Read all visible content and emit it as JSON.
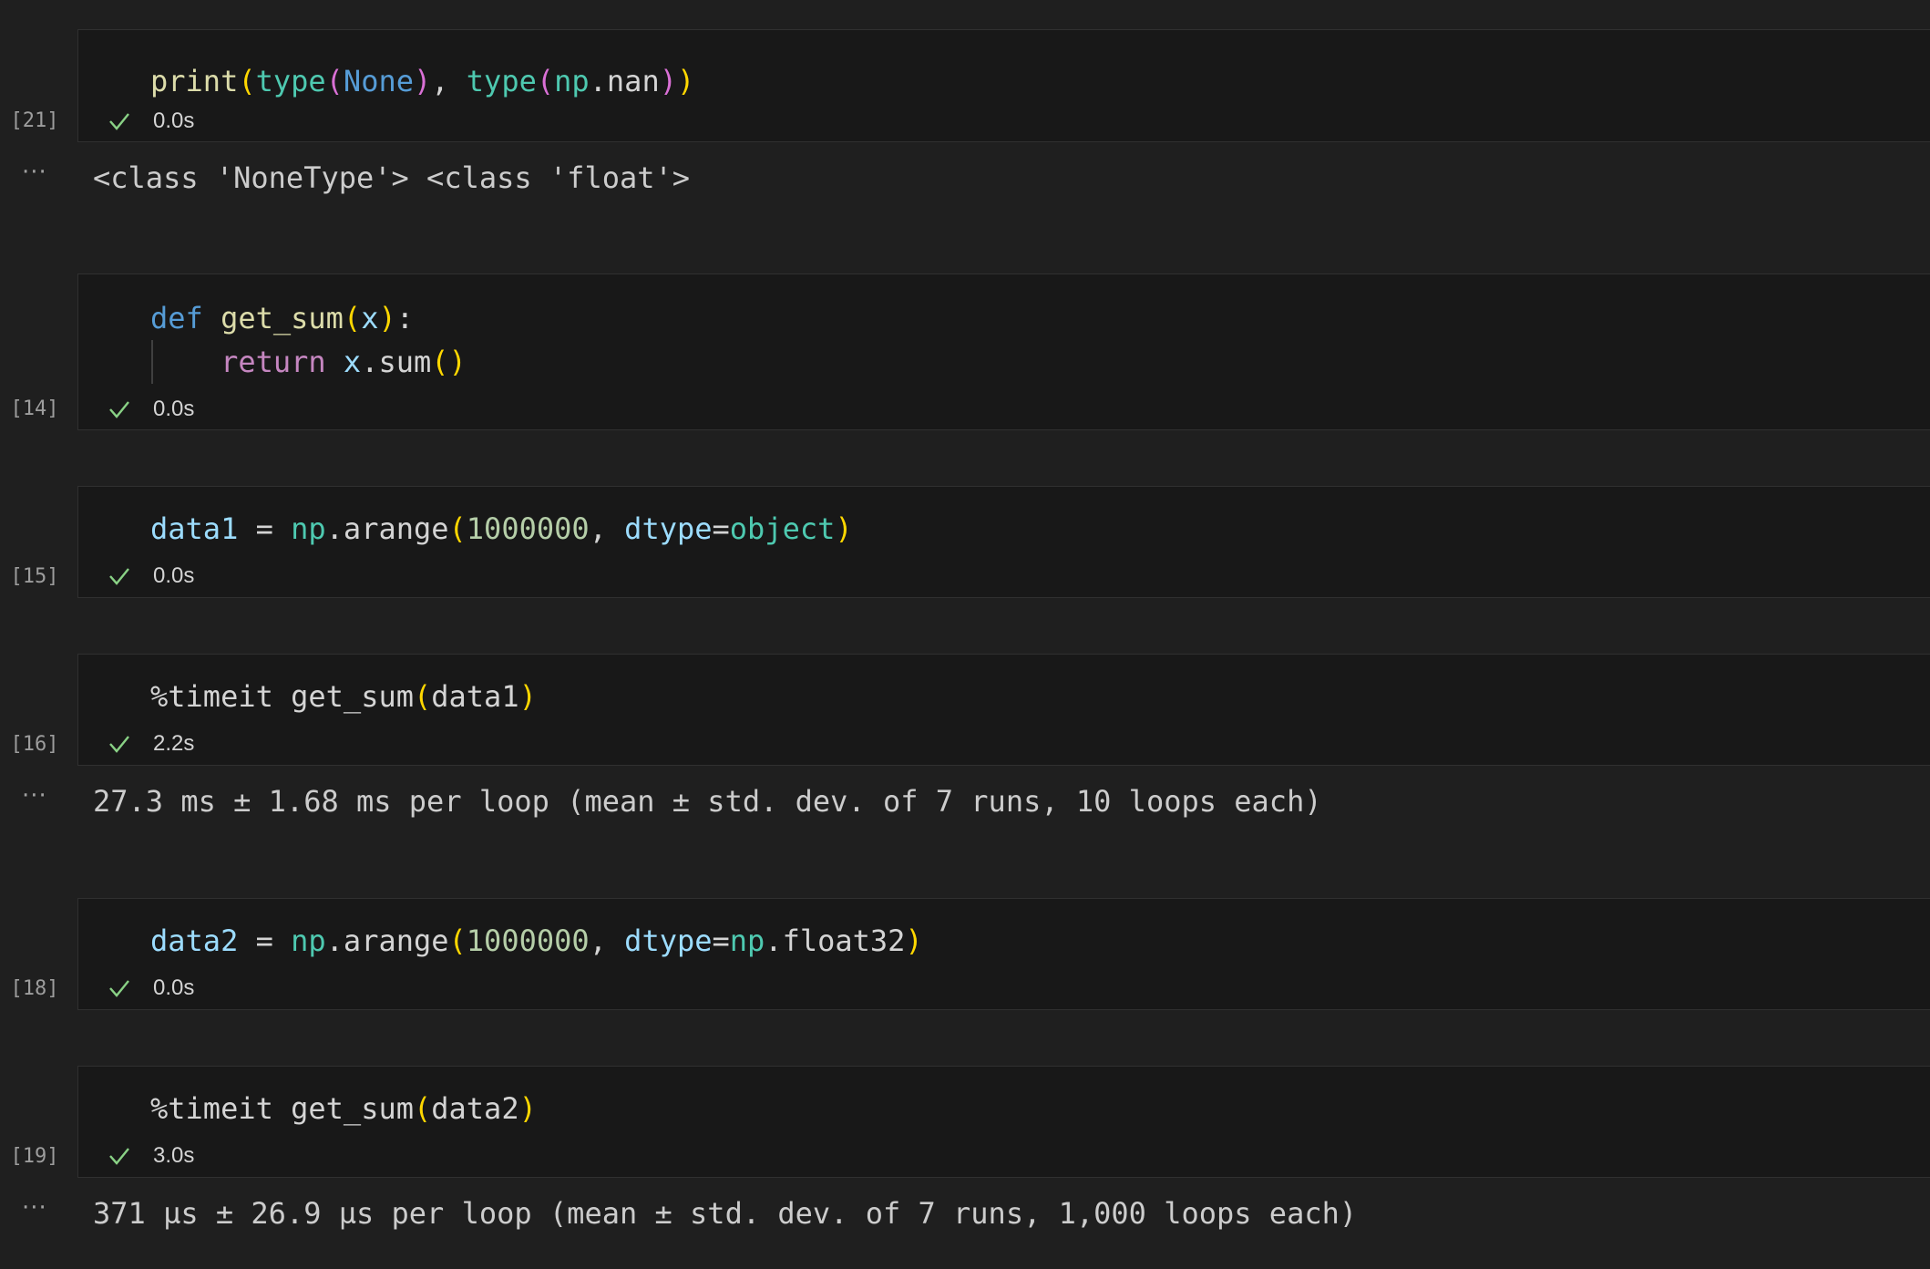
{
  "cells": [
    {
      "exec_count": "[21]",
      "code": [
        [
          {
            "t": "print",
            "c": "fn"
          },
          {
            "t": "(",
            "c": "p1"
          },
          {
            "t": "type",
            "c": "bi"
          },
          {
            "t": "(",
            "c": "p2"
          },
          {
            "t": "None",
            "c": "kw"
          },
          {
            "t": ")",
            "c": "p2"
          },
          {
            "t": ", ",
            "c": "plain"
          },
          {
            "t": "type",
            "c": "bi"
          },
          {
            "t": "(",
            "c": "p2"
          },
          {
            "t": "np",
            "c": "mod"
          },
          {
            "t": ".nan",
            "c": "plain"
          },
          {
            "t": ")",
            "c": "p2"
          },
          {
            "t": ")",
            "c": "p1"
          }
        ]
      ],
      "status": "success",
      "exec_time": "0.0s",
      "output": "<class 'NoneType'> <class 'float'>",
      "output_menu": "···"
    },
    {
      "exec_count": "[14]",
      "code": [
        [
          {
            "t": "def",
            "c": "kw"
          },
          {
            "t": " ",
            "c": "plain"
          },
          {
            "t": "get_sum",
            "c": "fn"
          },
          {
            "t": "(",
            "c": "p1"
          },
          {
            "t": "x",
            "c": "var"
          },
          {
            "t": ")",
            "c": "p1"
          },
          {
            "t": ":",
            "c": "plain"
          }
        ],
        [
          {
            "t": "    ",
            "c": "plain"
          },
          {
            "t": "return",
            "c": "kw2"
          },
          {
            "t": " ",
            "c": "plain"
          },
          {
            "t": "x",
            "c": "var"
          },
          {
            "t": ".sum",
            "c": "plain"
          },
          {
            "t": "()",
            "c": "p1"
          }
        ]
      ],
      "status": "success",
      "exec_time": "0.0s"
    },
    {
      "exec_count": "[15]",
      "code": [
        [
          {
            "t": "data1",
            "c": "var"
          },
          {
            "t": " = ",
            "c": "plain"
          },
          {
            "t": "np",
            "c": "mod"
          },
          {
            "t": ".arange",
            "c": "plain"
          },
          {
            "t": "(",
            "c": "p1"
          },
          {
            "t": "1000000",
            "c": "num"
          },
          {
            "t": ", ",
            "c": "plain"
          },
          {
            "t": "dtype",
            "c": "var"
          },
          {
            "t": "=",
            "c": "plain"
          },
          {
            "t": "object",
            "c": "bi"
          },
          {
            "t": ")",
            "c": "p1"
          }
        ]
      ],
      "status": "success",
      "exec_time": "0.0s"
    },
    {
      "exec_count": "[16]",
      "code": [
        [
          {
            "t": "%timeit get_sum",
            "c": "plain"
          },
          {
            "t": "(",
            "c": "p1"
          },
          {
            "t": "data1",
            "c": "plain"
          },
          {
            "t": ")",
            "c": "p1"
          }
        ]
      ],
      "status": "success",
      "exec_time": "2.2s",
      "output": "27.3 ms ± 1.68 ms per loop (mean ± std. dev. of 7 runs, 10 loops each)",
      "output_menu": "···"
    },
    {
      "exec_count": "[18]",
      "code": [
        [
          {
            "t": "data2",
            "c": "var"
          },
          {
            "t": " = ",
            "c": "plain"
          },
          {
            "t": "np",
            "c": "mod"
          },
          {
            "t": ".arange",
            "c": "plain"
          },
          {
            "t": "(",
            "c": "p1"
          },
          {
            "t": "1000000",
            "c": "num"
          },
          {
            "t": ", ",
            "c": "plain"
          },
          {
            "t": "dtype",
            "c": "var"
          },
          {
            "t": "=",
            "c": "plain"
          },
          {
            "t": "np",
            "c": "mod"
          },
          {
            "t": ".float32",
            "c": "plain"
          },
          {
            "t": ")",
            "c": "p1"
          }
        ]
      ],
      "status": "success",
      "exec_time": "0.0s"
    },
    {
      "exec_count": "[19]",
      "code": [
        [
          {
            "t": "%timeit get_sum",
            "c": "plain"
          },
          {
            "t": "(",
            "c": "p1"
          },
          {
            "t": "data2",
            "c": "plain"
          },
          {
            "t": ")",
            "c": "p1"
          }
        ]
      ],
      "status": "success",
      "exec_time": "3.0s",
      "output": "371 µs ± 26.9 µs per loop (mean ± std. dev. of 7 runs, 1,000 loops each)",
      "output_menu": "···"
    }
  ],
  "colors": {
    "success_check": "#89d185",
    "background": "#1f1f1f",
    "cell_background": "#181818"
  },
  "icons": {
    "status_success": "check-icon",
    "output_menu": "ellipsis-icon"
  }
}
